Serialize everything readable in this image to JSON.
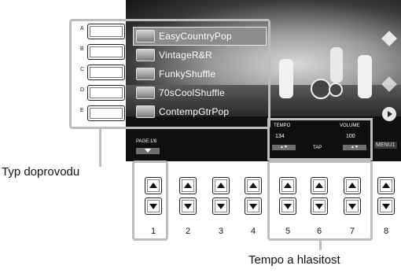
{
  "screen": {
    "styles": [
      {
        "label": "EasyCountryPop",
        "selected": true
      },
      {
        "label": "VintageR&R",
        "selected": false
      },
      {
        "label": "FunkyShuffle",
        "selected": false
      },
      {
        "label": "70sCoolShuffle",
        "selected": false
      },
      {
        "label": "ContempGtrPop",
        "selected": false
      }
    ],
    "page_label": "PAGE:1/8",
    "tempo": {
      "label": "TEMPO",
      "value": "134"
    },
    "tap_label": "TAP",
    "volume": {
      "label": "VOLUME",
      "value": "100"
    },
    "menu_label": "MENU1"
  },
  "side_buttons": [
    "A",
    "B",
    "C",
    "D",
    "E"
  ],
  "bottom_buttons": [
    "1",
    "2",
    "3",
    "4",
    "5",
    "6",
    "7",
    "8"
  ],
  "callouts": {
    "accompaniment_type": "Typ doprovodu",
    "tempo_volume": "Tempo a hlasitost"
  },
  "colors": {
    "frame": "#bdbdbd",
    "screen_bg": "#1a1a1a",
    "selected_bg": "#8c8c8c"
  }
}
